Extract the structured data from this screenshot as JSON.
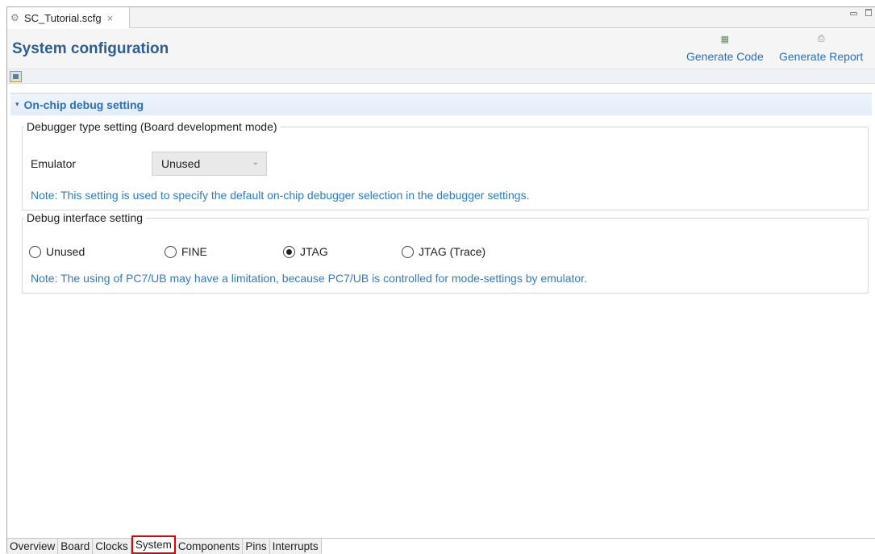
{
  "editor_tab": {
    "title": "SC_Tutorial.scfg",
    "close": "×"
  },
  "header": {
    "title": "System configuration",
    "actions": {
      "generate_code": "Generate Code",
      "generate_report": "Generate Report"
    }
  },
  "section": {
    "title": "On-chip debug setting"
  },
  "debugger_type": {
    "legend": "Debugger type setting (Board development mode)",
    "emulator_label": "Emulator",
    "emulator_value": "Unused",
    "note": "Note: This setting is used to specify the default on-chip debugger selection in the debugger settings."
  },
  "debug_interface": {
    "legend": "Debug interface setting",
    "options": [
      {
        "label": "Unused",
        "selected": false
      },
      {
        "label": "FINE",
        "selected": false
      },
      {
        "label": "JTAG",
        "selected": true
      },
      {
        "label": "JTAG (Trace)",
        "selected": false
      }
    ],
    "note": "Note: The using of PC7/UB may have a limitation, because PC7/UB is controlled for mode-settings by emulator."
  },
  "bottom_tabs": [
    {
      "label": "Overview",
      "active": false
    },
    {
      "label": "Board",
      "active": false
    },
    {
      "label": "Clocks",
      "active": false
    },
    {
      "label": "System",
      "active": true
    },
    {
      "label": "Components",
      "active": false
    },
    {
      "label": "Pins",
      "active": false
    },
    {
      "label": "Interrupts",
      "active": false
    }
  ],
  "colors": {
    "accent": "#2c6fb7",
    "title": "#2b5e91",
    "highlight": "#e10000"
  }
}
